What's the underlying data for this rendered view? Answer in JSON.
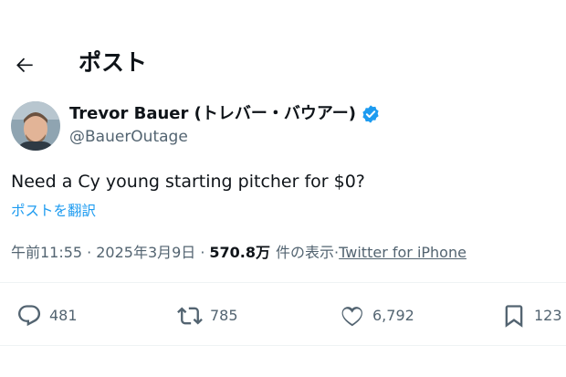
{
  "header": {
    "back_icon": "arrow-left-icon",
    "title": "ポスト"
  },
  "author": {
    "display_name": "Trevor Bauer (トレバー・バウアー)",
    "handle": "@BauerOutage",
    "verified_icon": "verified-badge-icon",
    "verified_color": "#1d9bf0"
  },
  "tweet": {
    "text": "Need a Cy young starting pitcher for $0?",
    "translate_label": "ポストを翻訳"
  },
  "meta": {
    "time": "午前11:55",
    "dot1": "·",
    "date": "2025年3月9日",
    "dot2": "·",
    "views": "570.8万",
    "views_suffix": "件の表示",
    "dot3": "·",
    "source": "Twitter for iPhone"
  },
  "actions": {
    "reply": {
      "icon": "reply-icon",
      "count": "481"
    },
    "repost": {
      "icon": "repost-icon",
      "count": "785"
    },
    "like": {
      "icon": "heart-icon",
      "count": "6,792"
    },
    "bookmark": {
      "icon": "bookmark-icon",
      "count": "123"
    }
  },
  "colors": {
    "text": "#0f1419",
    "secondary": "#536471",
    "accent": "#1d9bf0"
  }
}
